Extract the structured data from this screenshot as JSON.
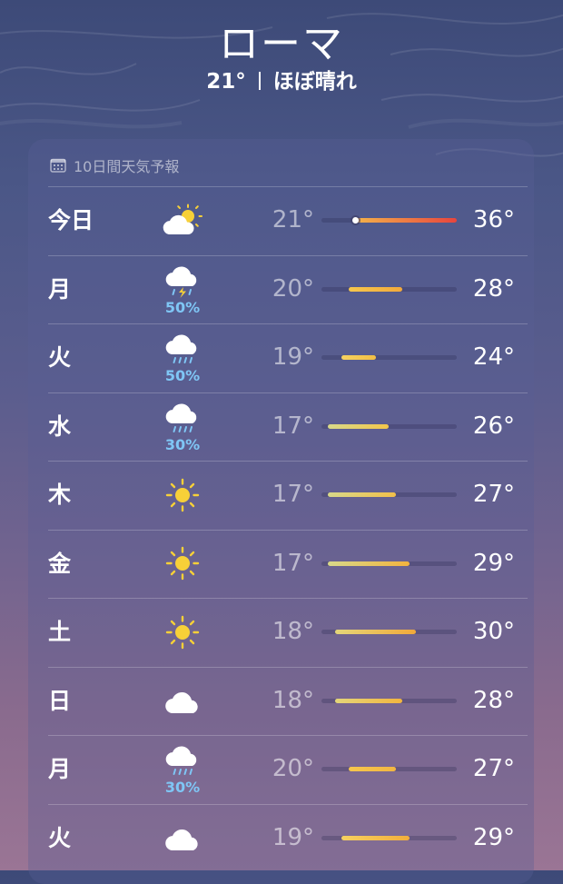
{
  "header": {
    "city": "ローマ",
    "current_temp": "21°",
    "condition": "ほぼ晴れ"
  },
  "forecast": {
    "title": "10日間天気予報",
    "scale_min": 16,
    "scale_max": 36,
    "days": [
      {
        "day": "今日",
        "icon": "partly-cloudy-icon",
        "precip": "",
        "low": "21°",
        "high": "36°",
        "low_val": 21,
        "high_val": 36,
        "current_val": 21,
        "colors": [
          "#f4b34a",
          "#e8453e"
        ]
      },
      {
        "day": "月",
        "icon": "thunderstorm-icon",
        "precip": "50%",
        "low": "20°",
        "high": "28°",
        "low_val": 20,
        "high_val": 28,
        "colors": [
          "#f6c74d",
          "#f2a93c"
        ]
      },
      {
        "day": "火",
        "icon": "rain-icon",
        "precip": "50%",
        "low": "19°",
        "high": "24°",
        "low_val": 19,
        "high_val": 24,
        "colors": [
          "#f6d160",
          "#f2bf45"
        ]
      },
      {
        "day": "水",
        "icon": "rain-icon",
        "precip": "30%",
        "low": "17°",
        "high": "26°",
        "low_val": 17,
        "high_val": 26,
        "colors": [
          "#d8d98a",
          "#f3c64a"
        ]
      },
      {
        "day": "木",
        "icon": "sun-icon",
        "precip": "",
        "low": "17°",
        "high": "27°",
        "low_val": 17,
        "high_val": 27,
        "colors": [
          "#d8d98a",
          "#f2c04a"
        ]
      },
      {
        "day": "金",
        "icon": "sun-icon",
        "precip": "",
        "low": "17°",
        "high": "29°",
        "low_val": 17,
        "high_val": 29,
        "colors": [
          "#d8d98a",
          "#f2b33e"
        ]
      },
      {
        "day": "土",
        "icon": "sun-icon",
        "precip": "",
        "low": "18°",
        "high": "30°",
        "low_val": 18,
        "high_val": 30,
        "colors": [
          "#e4d67a",
          "#f1a93a"
        ]
      },
      {
        "day": "日",
        "icon": "cloud-icon",
        "precip": "",
        "low": "18°",
        "high": "28°",
        "low_val": 18,
        "high_val": 28,
        "colors": [
          "#e4d67a",
          "#f2b53f"
        ]
      },
      {
        "day": "月",
        "icon": "rain-icon",
        "precip": "30%",
        "low": "20°",
        "high": "27°",
        "low_val": 20,
        "high_val": 27,
        "colors": [
          "#f6c74d",
          "#f2b642"
        ]
      },
      {
        "day": "火",
        "icon": "cloud-icon",
        "precip": "",
        "low": "19°",
        "high": "29°",
        "low_val": 19,
        "high_val": 29,
        "colors": [
          "#f6d160",
          "#f2ae3c"
        ]
      }
    ]
  }
}
